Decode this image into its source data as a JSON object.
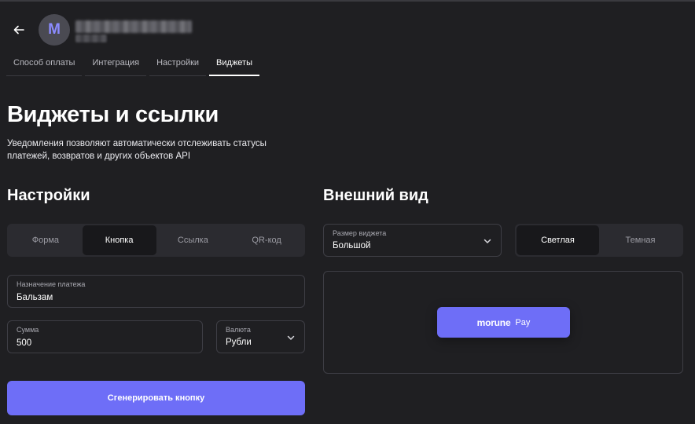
{
  "header": {
    "avatar_letter": "M",
    "back_icon": "arrow-left-icon"
  },
  "tabs": [
    {
      "label": "Способ оплаты",
      "active": false
    },
    {
      "label": "Интеграция",
      "active": false
    },
    {
      "label": "Настройки",
      "active": false
    },
    {
      "label": "Виджеты",
      "active": true
    }
  ],
  "page": {
    "title": "Виджеты и ссылки",
    "description": "Уведомления позволяют автоматически отслеживать статусы платежей, возвратов и других объектов API"
  },
  "settings": {
    "title": "Настройки",
    "type_options": [
      {
        "label": "Форма",
        "active": false
      },
      {
        "label": "Кнопка",
        "active": true
      },
      {
        "label": "Ссылка",
        "active": false
      },
      {
        "label": "QR-код",
        "active": false
      }
    ],
    "purpose": {
      "label": "Назначение платежа",
      "value": "Бальзам"
    },
    "sum": {
      "label": "Сумма",
      "value": "500"
    },
    "currency": {
      "label": "Валюта",
      "value": "Рубли"
    },
    "generate_label": "Сгенерировать кнопку"
  },
  "appearance": {
    "title": "Внешний вид",
    "size": {
      "label": "Размер виджета",
      "value": "Большой"
    },
    "theme_options": [
      {
        "label": "Светлая",
        "active": true
      },
      {
        "label": "Темная",
        "active": false
      }
    ],
    "preview": {
      "brand": "morune",
      "pay_label": "Pay"
    }
  },
  "colors": {
    "background": "#1f1f22",
    "accent": "#6e6ef7",
    "avatar_letter": "#8b8bff"
  }
}
